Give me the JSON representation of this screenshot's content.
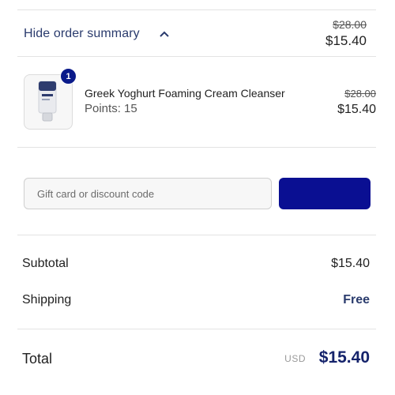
{
  "summary": {
    "toggle_label": "Hide order summary",
    "original_price": "$28.00",
    "price": "$15.40"
  },
  "cart": {
    "items": [
      {
        "quantity": "1",
        "name": "Greek Yoghurt Foaming Cream Cleanser",
        "points": "Points: 15",
        "original_price": "$28.00",
        "price": "$15.40",
        "image_icon": "product-tube-icon"
      }
    ]
  },
  "discount": {
    "placeholder": "Gift card or discount code",
    "value": "",
    "apply_label": ""
  },
  "totals": {
    "subtotal_label": "Subtotal",
    "subtotal_value": "$15.40",
    "shipping_label": "Shipping",
    "shipping_value": "Free",
    "total_label": "Total",
    "currency": "USD",
    "total_value": "$15.40"
  },
  "colors": {
    "accent": "#0a0f92",
    "link": "#2a3b6d",
    "total": "#15236b"
  }
}
